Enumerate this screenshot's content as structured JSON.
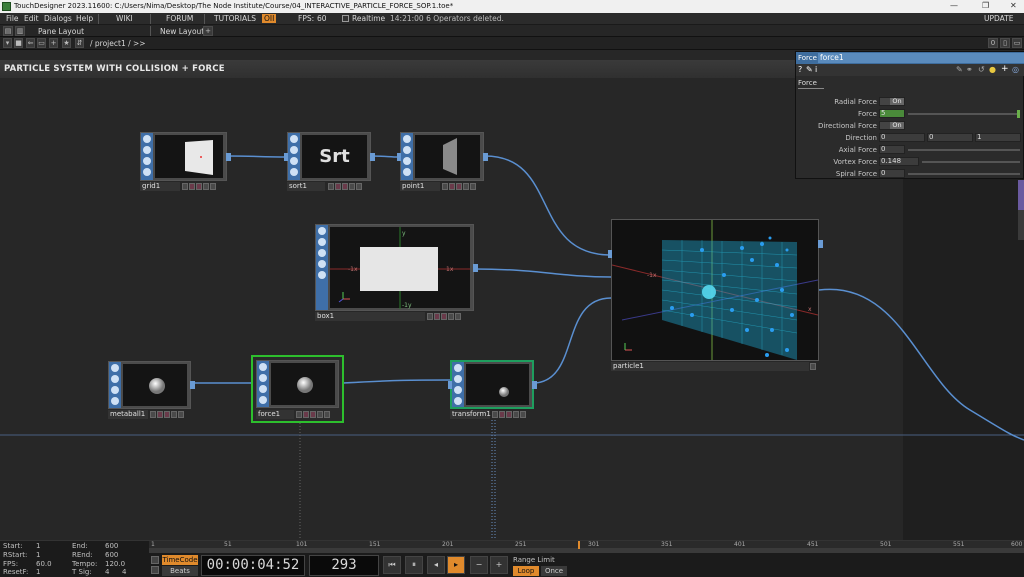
{
  "window": {
    "title": "TouchDesigner 2023.11600: C:/Users/Nima/Desktop/The Node Institute/Course/04_INTERACTIVE_PARTICLE_FORCE_SOP.1.toe*"
  },
  "menu": {
    "items": [
      "File",
      "Edit",
      "Dialogs",
      "Help"
    ],
    "wiki": "WIKI",
    "forum": "FORUM",
    "tutorials": "TUTORIALS",
    "oii": "OII",
    "fps_label": "FPS:",
    "fps_value": "60",
    "realtime": "Realtime",
    "status": "14:21:00 6 Operators deleted.",
    "update": "UPDATE"
  },
  "toolbar": {
    "pane_layout": "Pane Layout",
    "new_layout": "New Layout",
    "path": "/ project1 / >>",
    "pane_index": "0"
  },
  "network": {
    "title": "PARTICLE SYSTEM WITH COLLISION + FORCE",
    "nodes": {
      "grid": "grid1",
      "sort": "sort1",
      "sort_preview": "Srt",
      "point": "point1",
      "box": "box1",
      "particle": "particle1",
      "metaball": "metaball1",
      "force": "force1",
      "transform": "transform1"
    },
    "axis": {
      "y": "y",
      "x_neg": "-1x",
      "x_pos": "1x",
      "y_neg": "-1y",
      "x": "x"
    }
  },
  "params": {
    "op_type": "Force",
    "op_name": "force1",
    "tab": "Force",
    "rows": [
      {
        "label": "Radial Force",
        "value": "On"
      },
      {
        "label": "Force",
        "value": "5"
      },
      {
        "label": "Directional Force",
        "value": "On"
      },
      {
        "label": "Direction",
        "v1": "0",
        "v2": "0",
        "v3": "1"
      },
      {
        "label": "Axial Force",
        "value": "0"
      },
      {
        "label": "Vortex Force",
        "value": "0.148"
      },
      {
        "label": "Spiral Force",
        "value": "0"
      }
    ]
  },
  "timeline": {
    "start_label": "Start:",
    "start": "1",
    "end_label": "End:",
    "end": "600",
    "rstart_label": "RStart:",
    "rstart": "1",
    "rend_label": "REnd:",
    "rend": "600",
    "fps_label": "FPS:",
    "fps": "60.0",
    "tempo_label": "Tempo:",
    "tempo": "120.0",
    "resetf_label": "ResetF:",
    "resetf": "1",
    "tsig_label": "T Sig:",
    "tsig_a": "4",
    "tsig_b": "4",
    "timecode_btn": "TimeCode",
    "beats_btn": "Beats",
    "timecode": "00:00:04:52",
    "frame": "293",
    "range_limit": "Range Limit",
    "loop": "Loop",
    "once": "Once",
    "ticks": [
      "1",
      "51",
      "101",
      "151",
      "201",
      "251",
      "301",
      "351",
      "401",
      "451",
      "501",
      "551",
      "600"
    ]
  },
  "colors": {
    "accent": "#e08a2c",
    "wire": "#5a8fd0",
    "selected": "#2dbf2d",
    "param_header": "#3e6d9e"
  }
}
